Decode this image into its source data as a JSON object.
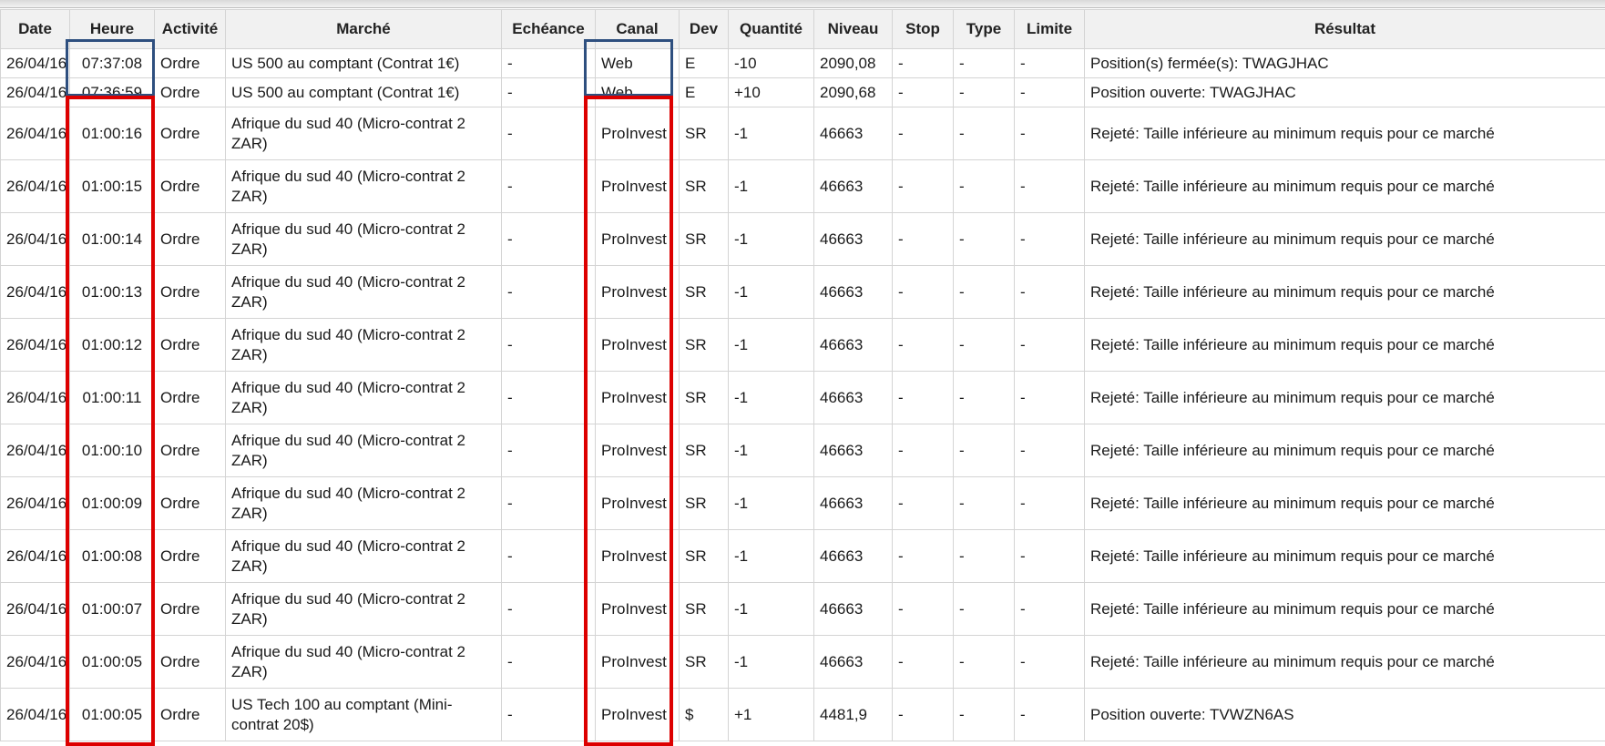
{
  "columns": [
    "Date",
    "Heure",
    "Activité",
    "Marché",
    "Echéance",
    "Canal",
    "Dev",
    "Quantité",
    "Niveau",
    "Stop",
    "Type",
    "Limite",
    "Résultat"
  ],
  "colors": {
    "blue_highlight": "#2e4f7f",
    "red_highlight": "#dd0000",
    "header_bg": "#f1f1f1",
    "grid": "#d4d4d4"
  },
  "rows": [
    {
      "date": "26/04/16",
      "heure": "07:37:08",
      "activite": "Ordre",
      "marche": "US 500 au comptant (Contrat 1€)",
      "echeance": "-",
      "canal": "Web",
      "dev": "E",
      "quantite": "-10",
      "niveau": "2090,08",
      "stop": "-",
      "type": "-",
      "limite": "-",
      "resultat": "Position(s) fermée(s): TWAGJHAC"
    },
    {
      "date": "26/04/16",
      "heure": "07:36:59",
      "activite": "Ordre",
      "marche": "US 500 au comptant (Contrat 1€)",
      "echeance": "-",
      "canal": "Web",
      "dev": "E",
      "quantite": "+10",
      "niveau": "2090,68",
      "stop": "-",
      "type": "-",
      "limite": "-",
      "resultat": "Position ouverte: TWAGJHAC"
    },
    {
      "date": "26/04/16",
      "heure": "01:00:16",
      "activite": "Ordre",
      "marche": "Afrique du sud 40 (Micro-contrat 2 ZAR)",
      "echeance": "-",
      "canal": "ProInvest",
      "dev": "SR",
      "quantite": "-1",
      "niveau": "46663",
      "stop": "-",
      "type": "-",
      "limite": "-",
      "resultat": "Rejeté: Taille inférieure au minimum requis pour ce marché"
    },
    {
      "date": "26/04/16",
      "heure": "01:00:15",
      "activite": "Ordre",
      "marche": "Afrique du sud 40 (Micro-contrat 2 ZAR)",
      "echeance": "-",
      "canal": "ProInvest",
      "dev": "SR",
      "quantite": "-1",
      "niveau": "46663",
      "stop": "-",
      "type": "-",
      "limite": "-",
      "resultat": "Rejeté: Taille inférieure au minimum requis pour ce marché"
    },
    {
      "date": "26/04/16",
      "heure": "01:00:14",
      "activite": "Ordre",
      "marche": "Afrique du sud 40 (Micro-contrat 2 ZAR)",
      "echeance": "-",
      "canal": "ProInvest",
      "dev": "SR",
      "quantite": "-1",
      "niveau": "46663",
      "stop": "-",
      "type": "-",
      "limite": "-",
      "resultat": "Rejeté: Taille inférieure au minimum requis pour ce marché"
    },
    {
      "date": "26/04/16",
      "heure": "01:00:13",
      "activite": "Ordre",
      "marche": "Afrique du sud 40 (Micro-contrat 2 ZAR)",
      "echeance": "-",
      "canal": "ProInvest",
      "dev": "SR",
      "quantite": "-1",
      "niveau": "46663",
      "stop": "-",
      "type": "-",
      "limite": "-",
      "resultat": "Rejeté: Taille inférieure au minimum requis pour ce marché"
    },
    {
      "date": "26/04/16",
      "heure": "01:00:12",
      "activite": "Ordre",
      "marche": "Afrique du sud 40 (Micro-contrat 2 ZAR)",
      "echeance": "-",
      "canal": "ProInvest",
      "dev": "SR",
      "quantite": "-1",
      "niveau": "46663",
      "stop": "-",
      "type": "-",
      "limite": "-",
      "resultat": "Rejeté: Taille inférieure au minimum requis pour ce marché"
    },
    {
      "date": "26/04/16",
      "heure": "01:00:11",
      "activite": "Ordre",
      "marche": "Afrique du sud 40 (Micro-contrat 2 ZAR)",
      "echeance": "-",
      "canal": "ProInvest",
      "dev": "SR",
      "quantite": "-1",
      "niveau": "46663",
      "stop": "-",
      "type": "-",
      "limite": "-",
      "resultat": "Rejeté: Taille inférieure au minimum requis pour ce marché"
    },
    {
      "date": "26/04/16",
      "heure": "01:00:10",
      "activite": "Ordre",
      "marche": "Afrique du sud 40 (Micro-contrat 2 ZAR)",
      "echeance": "-",
      "canal": "ProInvest",
      "dev": "SR",
      "quantite": "-1",
      "niveau": "46663",
      "stop": "-",
      "type": "-",
      "limite": "-",
      "resultat": "Rejeté: Taille inférieure au minimum requis pour ce marché"
    },
    {
      "date": "26/04/16",
      "heure": "01:00:09",
      "activite": "Ordre",
      "marche": "Afrique du sud 40 (Micro-contrat 2 ZAR)",
      "echeance": "-",
      "canal": "ProInvest",
      "dev": "SR",
      "quantite": "-1",
      "niveau": "46663",
      "stop": "-",
      "type": "-",
      "limite": "-",
      "resultat": "Rejeté: Taille inférieure au minimum requis pour ce marché"
    },
    {
      "date": "26/04/16",
      "heure": "01:00:08",
      "activite": "Ordre",
      "marche": "Afrique du sud 40 (Micro-contrat 2 ZAR)",
      "echeance": "-",
      "canal": "ProInvest",
      "dev": "SR",
      "quantite": "-1",
      "niveau": "46663",
      "stop": "-",
      "type": "-",
      "limite": "-",
      "resultat": "Rejeté: Taille inférieure au minimum requis pour ce marché"
    },
    {
      "date": "26/04/16",
      "heure": "01:00:07",
      "activite": "Ordre",
      "marche": "Afrique du sud 40 (Micro-contrat 2 ZAR)",
      "echeance": "-",
      "canal": "ProInvest",
      "dev": "SR",
      "quantite": "-1",
      "niveau": "46663",
      "stop": "-",
      "type": "-",
      "limite": "-",
      "resultat": "Rejeté: Taille inférieure au minimum requis pour ce marché"
    },
    {
      "date": "26/04/16",
      "heure": "01:00:05",
      "activite": "Ordre",
      "marche": "Afrique du sud 40 (Micro-contrat 2 ZAR)",
      "echeance": "-",
      "canal": "ProInvest",
      "dev": "SR",
      "quantite": "-1",
      "niveau": "46663",
      "stop": "-",
      "type": "-",
      "limite": "-",
      "resultat": "Rejeté: Taille inférieure au minimum requis pour ce marché"
    },
    {
      "date": "26/04/16",
      "heure": "01:00:05",
      "activite": "Ordre",
      "marche": "US Tech 100 au comptant (Mini-contrat 20$)",
      "echeance": "-",
      "canal": "ProInvest",
      "dev": "$",
      "quantite": "+1",
      "niveau": "4481,9",
      "stop": "-",
      "type": "-",
      "limite": "-",
      "resultat": "Position ouverte: TVWZN6AS"
    }
  ]
}
